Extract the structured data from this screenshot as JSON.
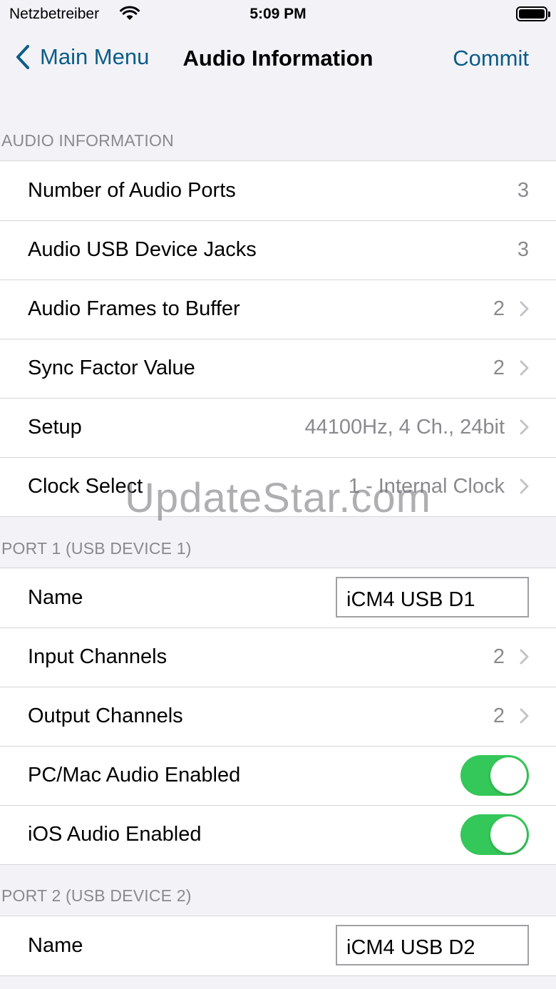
{
  "status_bar": {
    "carrier": "Netzbetreiber",
    "time": "5:09 PM"
  },
  "nav": {
    "back_label": "Main Menu",
    "title": "Audio Information",
    "commit_label": "Commit"
  },
  "colors": {
    "accent": "#0c5c86",
    "toggle_on": "#34c759",
    "secondary_text": "#8a8a8e",
    "background": "#f2f2f7"
  },
  "audio_info": {
    "header": "AUDIO INFORMATION",
    "rows": [
      {
        "label": "Number of Audio Ports",
        "value": "3"
      },
      {
        "label": "Audio USB Device Jacks",
        "value": "3"
      },
      {
        "label": "Audio Frames to Buffer",
        "value": "2"
      },
      {
        "label": "Sync Factor Value",
        "value": "2"
      },
      {
        "label": "Setup",
        "value": "44100Hz, 4 Ch., 24bit"
      },
      {
        "label": "Clock Select",
        "value": "1 - Internal Clock"
      }
    ]
  },
  "port1": {
    "header": "PORT 1 (USB DEVICE 1)",
    "name_label": "Name",
    "name_value": "iCM4 USB D1",
    "input_label": "Input Channels",
    "input_value": "2",
    "output_label": "Output Channels",
    "output_value": "2",
    "pc_audio_label": "PC/Mac Audio Enabled",
    "pc_audio_on": true,
    "ios_audio_label": "iOS Audio Enabled",
    "ios_audio_on": true
  },
  "port2": {
    "header": "PORT 2 (USB DEVICE 2)",
    "name_label": "Name",
    "name_value": "iCM4 USB D2"
  },
  "watermark": "UpdateStar.com"
}
